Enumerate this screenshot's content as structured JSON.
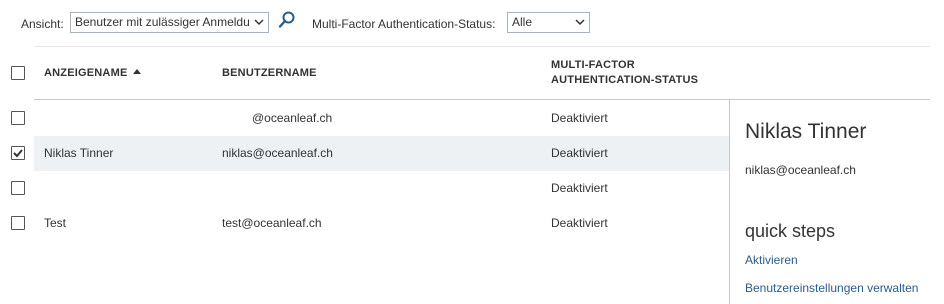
{
  "filterbar": {
    "view_label": "Ansicht:",
    "view_value": "Benutzer mit zulässiger Anmeldu",
    "mfa_label": "Multi-Factor Authentication-Status:",
    "mfa_value": "Alle"
  },
  "table": {
    "columns": [
      "ANZEIGENAME",
      "BENUTZERNAME",
      "MULTI-FACTOR",
      "AUTHENTICATION-STATUS"
    ],
    "sort_column": "ANZEIGENAME",
    "sort_direction": "ascending",
    "rows": [
      {
        "display_name": "",
        "username": "@oceanleaf.ch",
        "mfa_status": "Deaktiviert",
        "checked": false
      },
      {
        "display_name": "Niklas Tinner",
        "username": "niklas@oceanleaf.ch",
        "mfa_status": "Deaktiviert",
        "checked": true
      },
      {
        "display_name": "",
        "username": "",
        "mfa_status": "Deaktiviert",
        "checked": false
      },
      {
        "display_name": "Test",
        "username": "test@oceanleaf.ch",
        "mfa_status": "Deaktiviert",
        "checked": false
      }
    ]
  },
  "detail_panel": {
    "name": "Niklas Tinner",
    "email": "niklas@oceanleaf.ch",
    "quick_steps_heading": "quick steps",
    "links": [
      "Aktivieren",
      "Benutzereinstellungen verwalten"
    ]
  },
  "colors": {
    "link": "#2a5d8f",
    "selected_row": "#eef1f3",
    "divider": "#c8c8c8"
  },
  "icons": {
    "search": "search-icon",
    "dropdown": "chevron-down-icon",
    "check": "check-icon",
    "sort": "sort-ascending-icon"
  }
}
